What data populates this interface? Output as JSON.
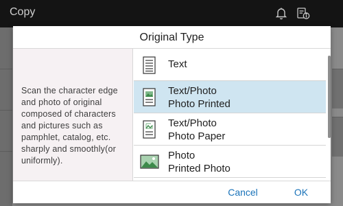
{
  "app": {
    "title": "Copy",
    "header_icons": [
      "bell-icon",
      "info-icon"
    ]
  },
  "dialog": {
    "title": "Original Type",
    "description": "Scan the character edge and photo of original composed of characters and pictures such as pamphlet, catalog, etc. sharply and smoothly(or uniformly).",
    "items": [
      {
        "line1": "Text",
        "line2": "",
        "icon": "text-document-icon",
        "selected": false
      },
      {
        "line1": "Text/Photo",
        "line2": "Photo Printed",
        "icon": "text-photo-printed-icon",
        "selected": true
      },
      {
        "line1": "Text/Photo",
        "line2": "Photo Paper",
        "icon": "text-photo-paper-icon",
        "selected": false
      },
      {
        "line1": "Photo",
        "line2": "Printed Photo",
        "icon": "photo-icon",
        "selected": false
      }
    ],
    "cancel_label": "Cancel",
    "ok_label": "OK"
  },
  "colors": {
    "selected_row": "#cfe5f1",
    "button_text": "#1a73b9",
    "header_bg": "#141414"
  }
}
